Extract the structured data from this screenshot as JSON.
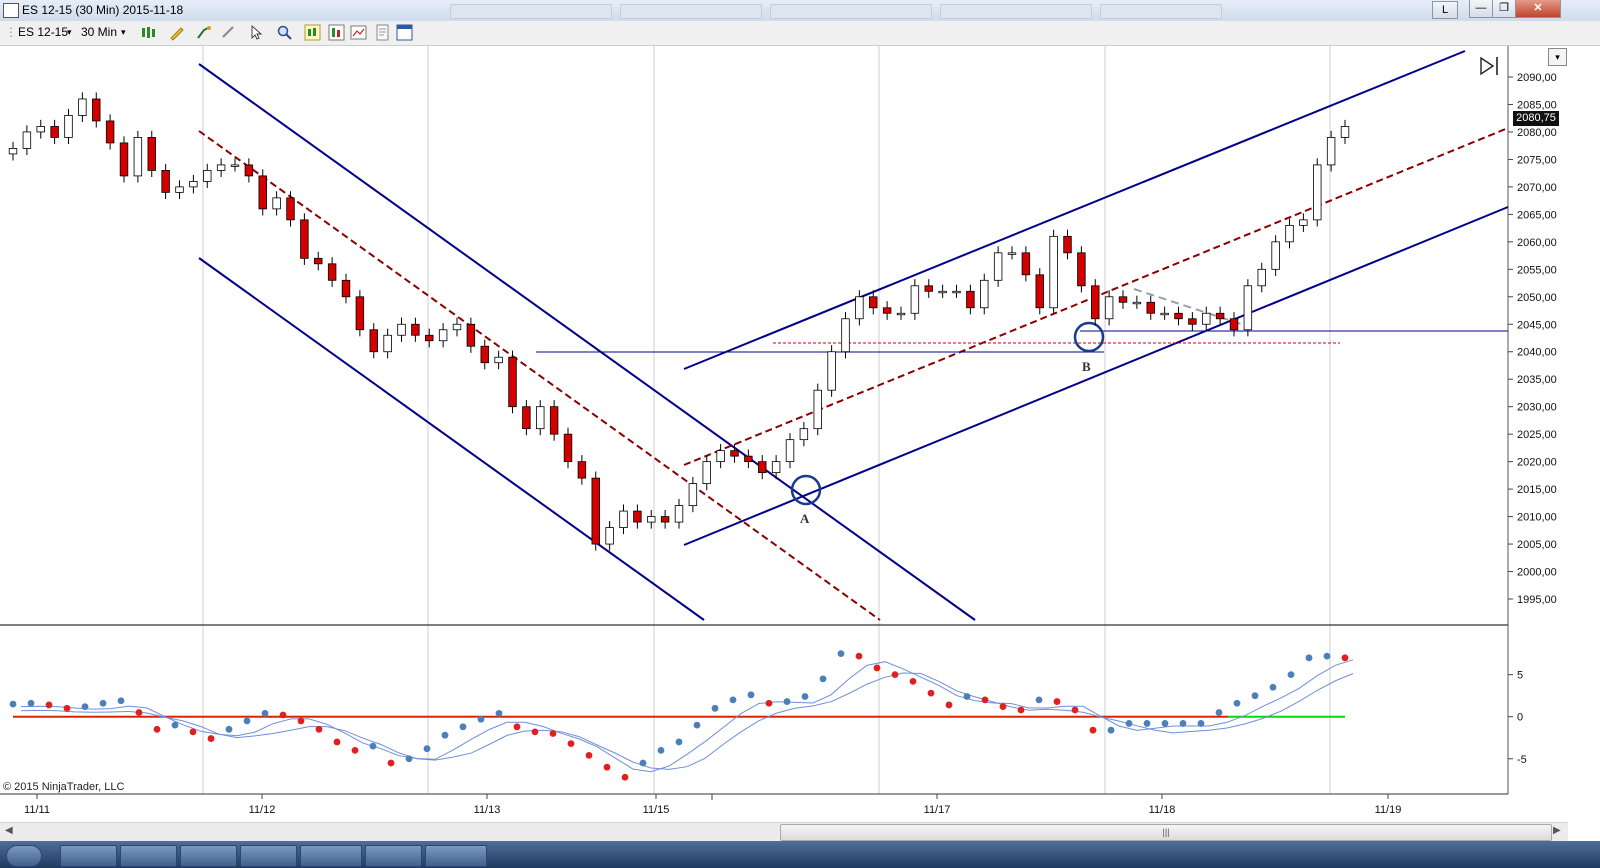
{
  "window": {
    "title": "ES 12-15 (30 Min)  2015-11-18",
    "button_layout": "L",
    "minimize_glyph": "—",
    "restore_glyph": "❐",
    "close_glyph": "✕"
  },
  "toolbar": {
    "instrument": "ES 12-15",
    "interval": "30 Min",
    "dropdown_glyph": "▾",
    "icons": [
      "bar-type-icon",
      "drawing-pencil-icon",
      "indicator-icon",
      "strategy-icon",
      "cursor-pointer-icon",
      "zoom-icon",
      "chart-style-icon",
      "data-series-icon",
      "properties-icon",
      "template-icon",
      "window-link-icon"
    ]
  },
  "price_chart": {
    "type": "candlestick",
    "instrument": "ES 12-15",
    "timeframe": "30 Min",
    "last_price": "2080,75",
    "price_axis_ticks": [
      "2090,00",
      "2085,00",
      "2080,00",
      "2075,00",
      "2070,00",
      "2065,00",
      "2060,00",
      "2055,00",
      "2050,00",
      "2045,00",
      "2040,00",
      "2035,00",
      "2030,00",
      "2025,00",
      "2020,00",
      "2015,00",
      "2010,00",
      "2005,00",
      "2000,00",
      "1995,00"
    ],
    "price_range": [
      1993,
      2092
    ],
    "time_axis_labels": [
      "11/11",
      "11/12",
      "11/13",
      "11/15",
      "11/17",
      "11/18",
      "11/19"
    ],
    "annotations": [
      "A",
      "B"
    ],
    "colors": {
      "up_candle": "#ffffff",
      "down_candle": "#d40000",
      "channel": "#00008b",
      "median_line": "#8b0000",
      "grid": "#c8c8c8"
    }
  },
  "chart_data": {
    "type": "line",
    "series": [
      {
        "values": [
          2077,
          2080,
          2081,
          2079,
          2083,
          2086,
          2082,
          2078,
          2072,
          2079,
          2073,
          2069,
          2070,
          2071,
          2073,
          2074,
          2074,
          2072,
          2066,
          2068,
          2064,
          2057,
          2056,
          2053,
          2050,
          2044,
          2040,
          2043,
          2045,
          2043,
          2042,
          2044,
          2045,
          2041,
          2038,
          2039,
          2030,
          2026,
          2030,
          2025,
          2020,
          2017,
          2005,
          2008,
          2011,
          2009,
          2010,
          2009,
          2012,
          2016,
          2020,
          2022,
          2021,
          2020,
          2018,
          2020,
          2024,
          2026,
          2033,
          2040,
          2046,
          2050,
          2048,
          2047,
          2047,
          2052,
          2051,
          2051,
          2051,
          2048,
          2053,
          2058,
          2058,
          2054,
          2048,
          2061,
          2058,
          2052,
          2046,
          2050,
          2049,
          2049,
          2047,
          2047,
          2046,
          2045,
          2047,
          2046,
          2044,
          2052,
          2055,
          2060,
          2063,
          2064,
          2074,
          2079,
          2081
        ]
      }
    ],
    "ylim": [
      1993,
      2092
    ]
  },
  "oscillator": {
    "y_ticks": [
      "5",
      "0",
      "-5"
    ],
    "y_range": [
      -8,
      9
    ],
    "values": [
      1.5,
      1.6,
      1.4,
      1.0,
      1.2,
      1.6,
      1.9,
      0.5,
      -1.5,
      -1.0,
      -1.8,
      -2.6,
      -1.5,
      -0.5,
      0.4,
      0.2,
      -0.5,
      -1.5,
      -3.0,
      -4.0,
      -3.5,
      -5.5,
      -5.0,
      -3.8,
      -2.2,
      -1.2,
      -0.3,
      0.4,
      -1.2,
      -1.8,
      -2.0,
      -3.2,
      -4.6,
      -6.0,
      -7.2,
      -5.5,
      -4.0,
      -3.0,
      -1.0,
      1.0,
      2.0,
      2.6,
      1.6,
      1.8,
      2.4,
      4.5,
      7.5,
      7.2,
      5.8,
      5.0,
      4.2,
      2.8,
      1.4,
      2.4,
      2.0,
      1.2,
      0.8,
      2.0,
      1.8,
      0.8,
      -1.6,
      -1.6,
      -0.8,
      -0.8,
      -0.8,
      -0.8,
      -0.8,
      0.5,
      1.6,
      2.5,
      3.5,
      5.0,
      7.0,
      7.2,
      7.0
    ],
    "zero_line_color": "#ff0000",
    "signal_line_color": "#00dd00"
  },
  "copyright": "© 2015 NinjaTrader, LLC"
}
